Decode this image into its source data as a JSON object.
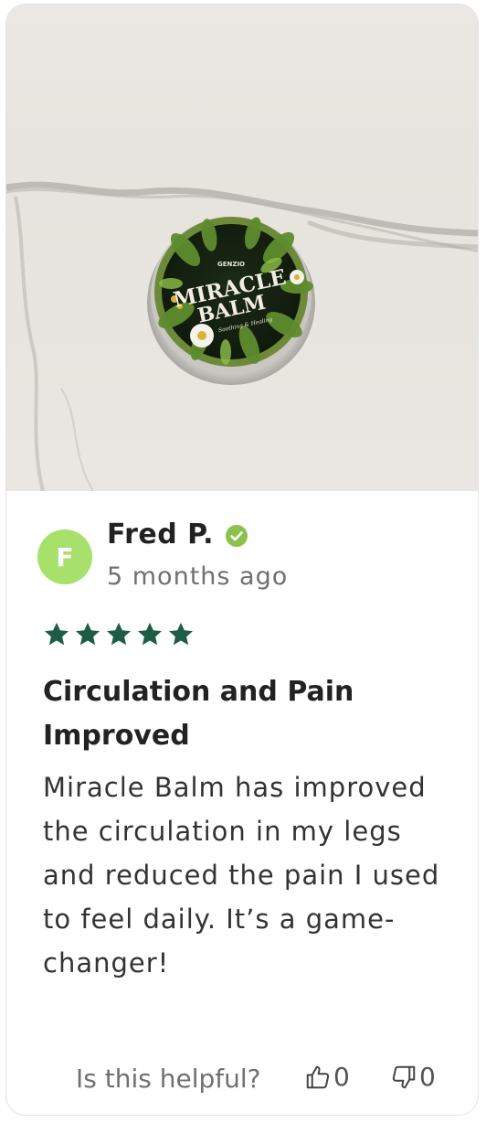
{
  "review": {
    "avatar_initial": "F",
    "reviewer_name": "Fred P.",
    "time_ago": "5 months ago",
    "rating": 5,
    "title": "Circulation and Pain Improved",
    "body": "Miracle Balm has improved the circulation in my legs and reduced the pain I used to feel daily. It’s a game-changer!",
    "product_label": {
      "brand": "GENZIO",
      "line1": "MIRACLE",
      "line2": "BALM",
      "tagline": "Soothing & Healing"
    }
  },
  "footer": {
    "helpful_label": "Is this helpful?",
    "thumbs_up_count": "0",
    "thumbs_down_count": "0"
  },
  "colors": {
    "avatar_bg": "#a7e06b",
    "star": "#1f5c45",
    "verified": "#8bc34a"
  },
  "icons": {
    "verified": "check-badge-icon",
    "star": "star-icon",
    "thumbs_up": "thumbs-up-icon",
    "thumbs_down": "thumbs-down-icon"
  }
}
